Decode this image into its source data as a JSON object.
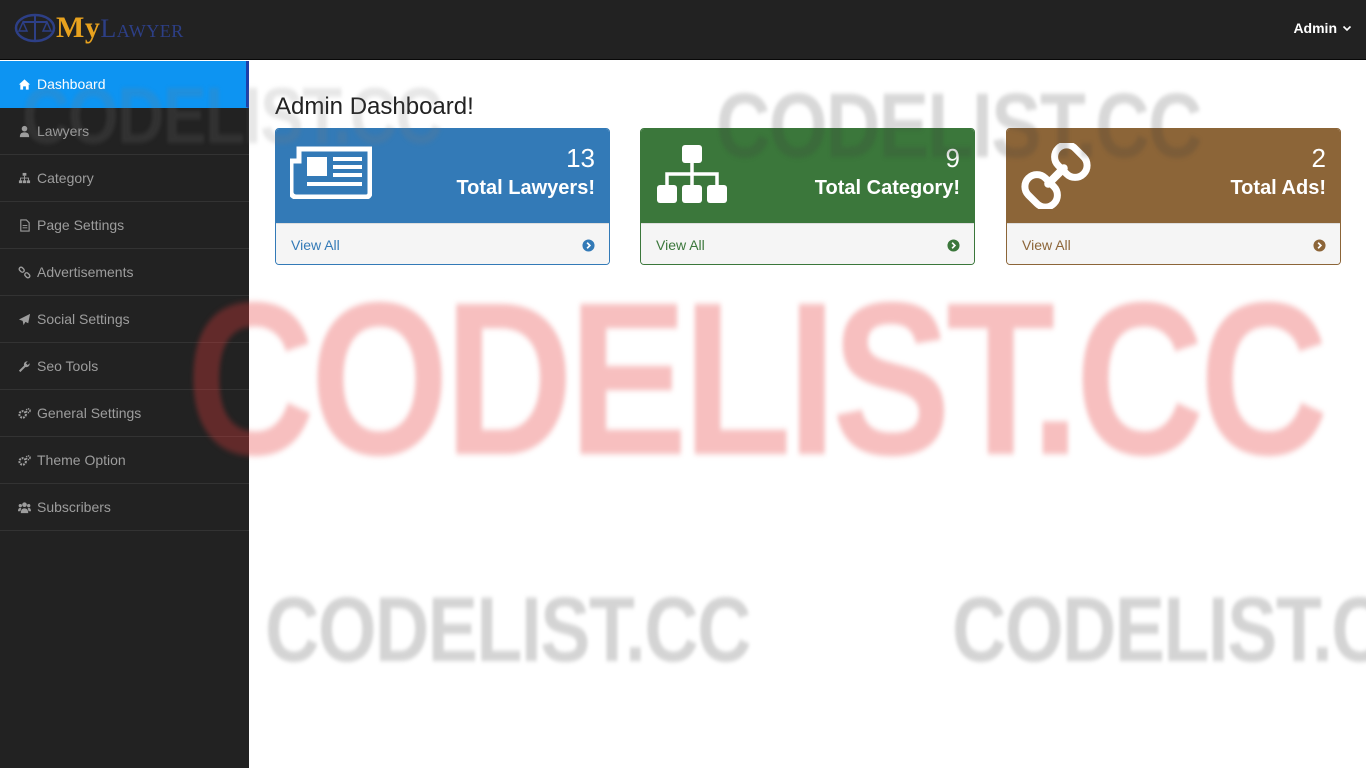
{
  "brand": {
    "my": "My",
    "lawyer": "Lawyer"
  },
  "user": {
    "name": "Admin"
  },
  "sidebar": {
    "items": [
      {
        "label": "Dashboard",
        "icon": "home-icon",
        "active": true
      },
      {
        "label": "Lawyers",
        "icon": "user-tie-icon"
      },
      {
        "label": "Category",
        "icon": "sitemap-icon"
      },
      {
        "label": "Page Settings",
        "icon": "file-icon"
      },
      {
        "label": "Advertisements",
        "icon": "link-icon"
      },
      {
        "label": "Social Settings",
        "icon": "paper-plane-icon"
      },
      {
        "label": "Seo Tools",
        "icon": "wrench-icon"
      },
      {
        "label": "General Settings",
        "icon": "cogs-icon"
      },
      {
        "label": "Theme Option",
        "icon": "cogs-icon"
      },
      {
        "label": "Subscribers",
        "icon": "users-icon"
      }
    ]
  },
  "main": {
    "title": "Admin Dashboard!",
    "panels": [
      {
        "count": "13",
        "label": "Total Lawyers!",
        "footer": "View All",
        "icon": "newspaper-icon",
        "color": "#337ab7"
      },
      {
        "count": "9",
        "label": "Total Category!",
        "footer": "View All",
        "icon": "sitemap-icon",
        "color": "#3b773b"
      },
      {
        "count": "2",
        "label": "Total Ads!",
        "footer": "View All",
        "icon": "chain-link-icon",
        "color": "#8c6538"
      }
    ]
  },
  "watermark": {
    "text": "CODELIST.CC"
  }
}
